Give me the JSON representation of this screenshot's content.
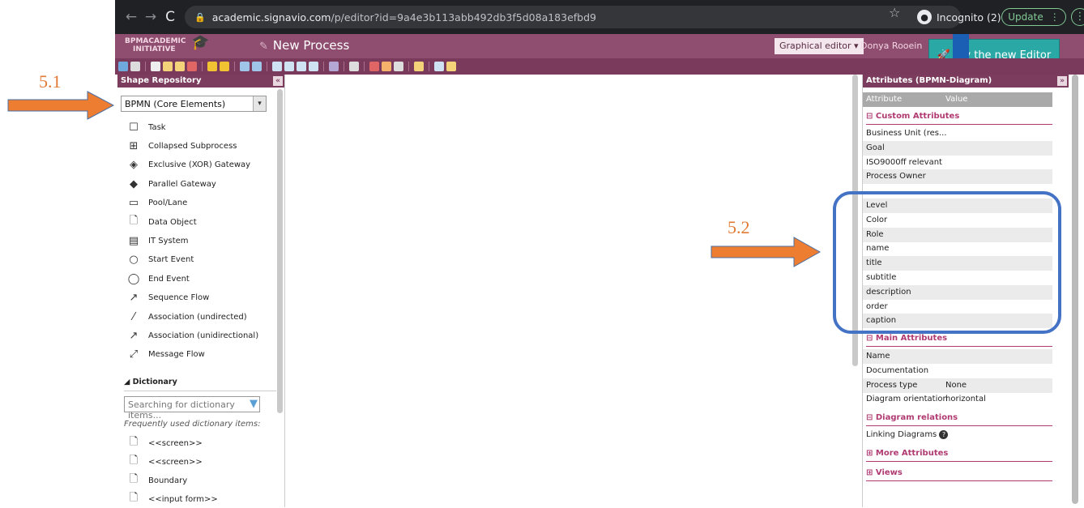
{
  "annotations": {
    "a51": "5.1",
    "a52": "5.2"
  },
  "browser": {
    "url_host": "academic.signavio.com",
    "url_path": "/p/editor?id=9a4e3b113abb492db3f5d08a183efbd9",
    "incognito": "Incognito (2)",
    "update": "Update"
  },
  "app": {
    "logo_top": "BPMACADEMIC",
    "logo_bottom": "INITIATIVE",
    "title": "New Process",
    "editor_mode": "Graphical editor",
    "user": "Donya Rooein",
    "try_new": "Try the new Editor"
  },
  "left": {
    "header": "Shape Repository",
    "stencil": "BPMN (Core Elements)",
    "shapes": [
      {
        "label": "Task",
        "icon": "task-icon"
      },
      {
        "label": "Collapsed Subprocess",
        "icon": "subprocess-icon"
      },
      {
        "label": "Exclusive (XOR) Gateway",
        "icon": "xor-gateway-icon"
      },
      {
        "label": "Parallel Gateway",
        "icon": "parallel-gateway-icon"
      },
      {
        "label": "Pool/Lane",
        "icon": "pool-icon"
      },
      {
        "label": "Data Object",
        "icon": "data-object-icon"
      },
      {
        "label": "IT System",
        "icon": "it-system-icon"
      },
      {
        "label": "Start Event",
        "icon": "start-event-icon"
      },
      {
        "label": "End Event",
        "icon": "end-event-icon"
      },
      {
        "label": "Sequence Flow",
        "icon": "sequence-flow-icon"
      },
      {
        "label": "Association (undirected)",
        "icon": "association-icon"
      },
      {
        "label": "Association (unidirectional)",
        "icon": "association-uni-icon"
      },
      {
        "label": "Message Flow",
        "icon": "message-flow-icon"
      }
    ],
    "dictionary": "Dictionary",
    "dict_placeholder": "Searching for dictionary items...",
    "frequent": "Frequently used dictionary items:",
    "dict_items": [
      "<<screen>>",
      "<<screen>>",
      "Boundary",
      "<<input form>>"
    ]
  },
  "right": {
    "header": "Attributes (BPMN-Diagram)",
    "col_attr": "Attribute",
    "col_val": "Value",
    "custom": "Custom Attributes",
    "custom_rows": [
      "Business Unit (res...",
      "Goal",
      "ISO9000ff relevant",
      "Process Owner",
      "",
      "Level",
      "Color",
      "Role",
      "name",
      "title",
      "subtitle",
      "description",
      "order",
      "caption"
    ],
    "main": "Main Attributes",
    "main_rows": [
      {
        "a": "Name",
        "v": ""
      },
      {
        "a": "Documentation",
        "v": ""
      },
      {
        "a": "Process type",
        "v": "None"
      },
      {
        "a": "Diagram orientation",
        "v": "horizontal"
      }
    ],
    "relations": "Diagram relations",
    "linking": "Linking Diagrams",
    "more": "More Attributes",
    "views": "Views"
  },
  "colors": {
    "accent": "#8f4e6f",
    "section": "#b03a72",
    "arrow": "#ed7d31",
    "highlight": "#4472c4"
  }
}
